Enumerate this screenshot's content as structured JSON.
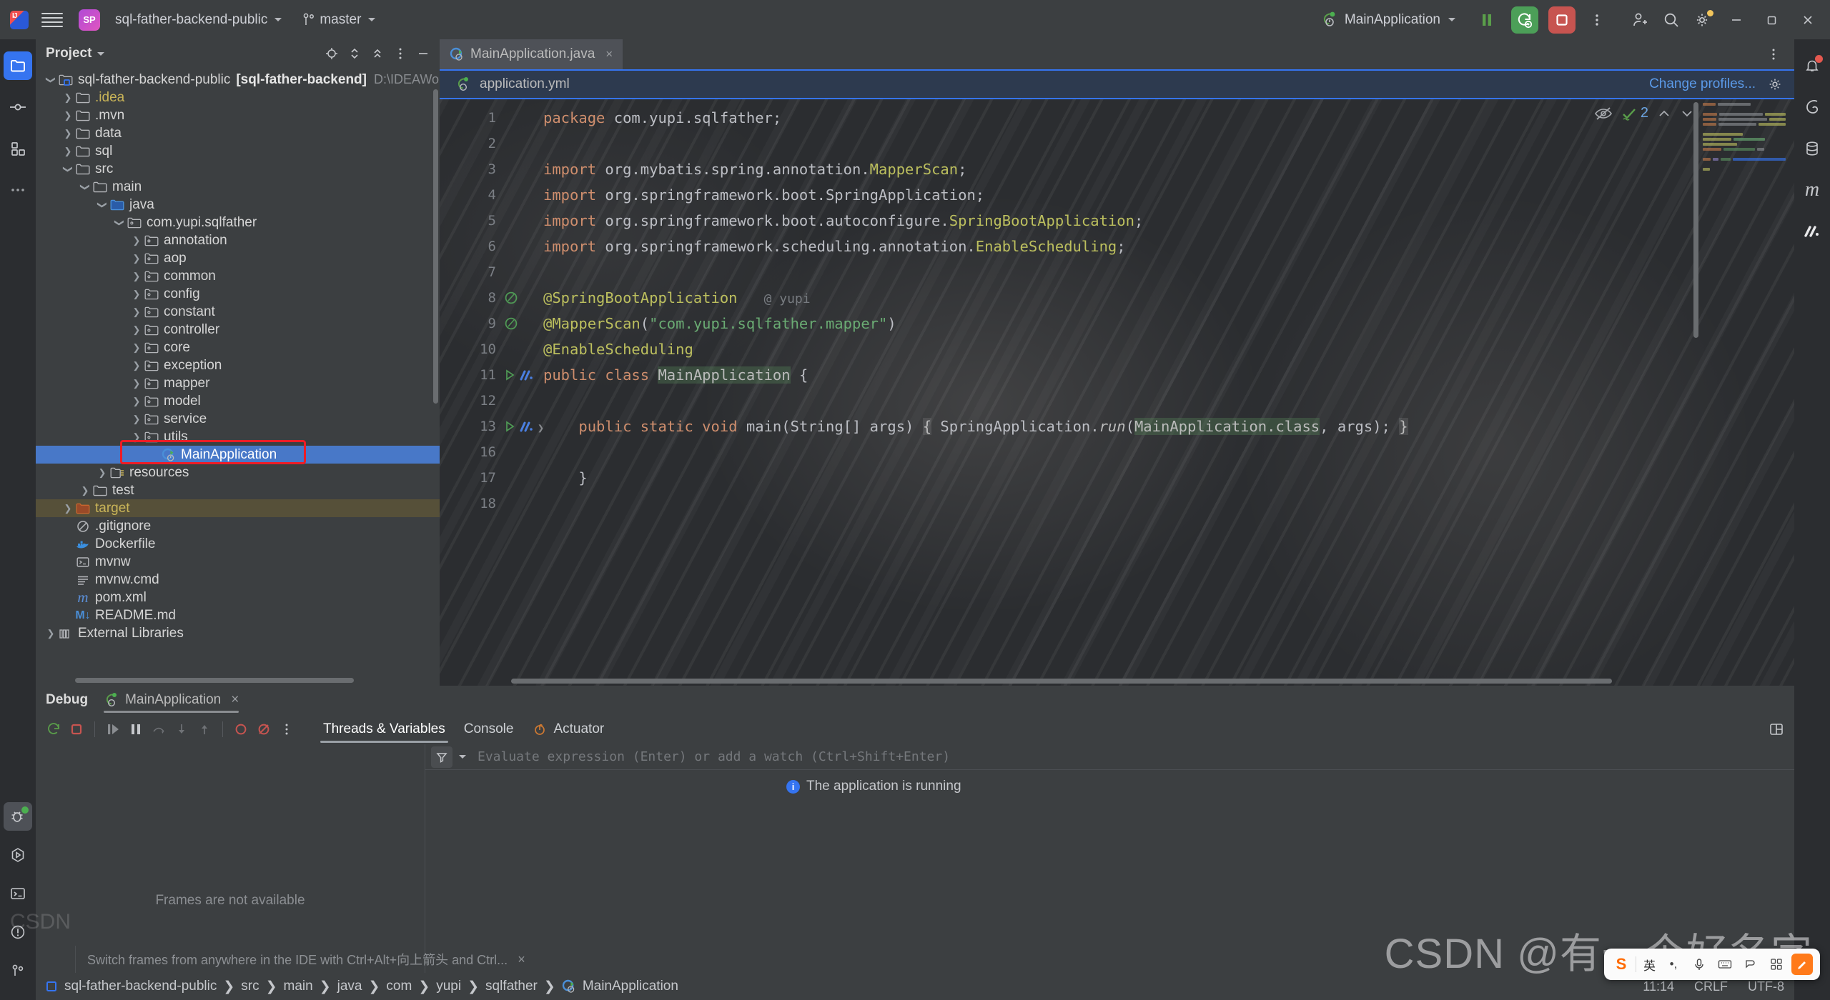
{
  "titlebar": {
    "project_badge": "SP",
    "project_name": "sql-father-backend-public",
    "branch": "master",
    "run_config": "MainApplication",
    "buttons": {
      "pause": "pause-icon",
      "rerun_debug": "rerun-debug-icon",
      "stop": "stop-icon",
      "more": "more-options-icon",
      "add_user": "add-user-icon",
      "search": "search-icon",
      "settings": "settings-icon",
      "minimize": "minimize",
      "maximize": "maximize",
      "close": "close"
    }
  },
  "left_rail": [
    {
      "name": "project-tool-window",
      "icon": "folder-icon",
      "active": true
    },
    {
      "name": "commit-tool-window",
      "icon": "commit-icon",
      "active": false
    },
    {
      "name": "structure-tool-window",
      "icon": "structure-icon",
      "active": false
    },
    {
      "name": "more-tool-windows",
      "icon": "ellipsis-icon",
      "active": false
    }
  ],
  "left_rail_bottom": [
    {
      "name": "debug-tool-window",
      "icon": "bug-icon",
      "active": true
    },
    {
      "name": "run-tool-window",
      "icon": "run-icon",
      "active": false
    },
    {
      "name": "terminal-tool-window",
      "icon": "terminal-icon",
      "active": false
    },
    {
      "name": "problems-tool-window",
      "icon": "warning-icon",
      "active": false
    },
    {
      "name": "version-control-tool-window",
      "icon": "branch-icon",
      "active": false
    }
  ],
  "right_rail": [
    {
      "name": "notifications",
      "icon": "bell-icon",
      "badge": true
    },
    {
      "name": "spring",
      "icon": "spring-leaf-icon"
    },
    {
      "name": "database",
      "icon": "database-icon"
    },
    {
      "name": "maven",
      "icon": "maven-m-icon"
    },
    {
      "name": "ai-assistant",
      "icon": "ai-icon"
    }
  ],
  "project_panel": {
    "title": "Project",
    "tools": [
      "locate-icon",
      "expand-collapse-icon",
      "collapse-all-icon",
      "options-icon",
      "hide-icon"
    ],
    "tree": [
      {
        "depth": 0,
        "arrow": "down",
        "icon": "module-icon",
        "label": "sql-father-backend-public",
        "bold": "[sql-father-backend]",
        "sub": "D:\\IDEAWorkSpace"
      },
      {
        "depth": 1,
        "arrow": "right",
        "icon": "folder-icon",
        "label": ".idea",
        "style": "idea"
      },
      {
        "depth": 1,
        "arrow": "right",
        "icon": "folder-icon",
        "label": ".mvn"
      },
      {
        "depth": 1,
        "arrow": "right",
        "icon": "folder-icon",
        "label": "data"
      },
      {
        "depth": 1,
        "arrow": "right",
        "icon": "folder-icon",
        "label": "sql"
      },
      {
        "depth": 1,
        "arrow": "down",
        "icon": "folder-icon",
        "label": "src"
      },
      {
        "depth": 2,
        "arrow": "down",
        "icon": "folder-icon",
        "label": "main"
      },
      {
        "depth": 3,
        "arrow": "down",
        "icon": "source-folder-icon",
        "label": "java"
      },
      {
        "depth": 4,
        "arrow": "down",
        "icon": "package-icon",
        "label": "com.yupi.sqlfather"
      },
      {
        "depth": 5,
        "arrow": "right",
        "icon": "package-icon",
        "label": "annotation"
      },
      {
        "depth": 5,
        "arrow": "right",
        "icon": "package-icon",
        "label": "aop"
      },
      {
        "depth": 5,
        "arrow": "right",
        "icon": "package-icon",
        "label": "common"
      },
      {
        "depth": 5,
        "arrow": "right",
        "icon": "package-icon",
        "label": "config"
      },
      {
        "depth": 5,
        "arrow": "right",
        "icon": "package-icon",
        "label": "constant"
      },
      {
        "depth": 5,
        "arrow": "right",
        "icon": "package-icon",
        "label": "controller"
      },
      {
        "depth": 5,
        "arrow": "right",
        "icon": "package-icon",
        "label": "core"
      },
      {
        "depth": 5,
        "arrow": "right",
        "icon": "package-icon",
        "label": "exception"
      },
      {
        "depth": 5,
        "arrow": "right",
        "icon": "package-icon",
        "label": "mapper"
      },
      {
        "depth": 5,
        "arrow": "right",
        "icon": "package-icon",
        "label": "model"
      },
      {
        "depth": 5,
        "arrow": "right",
        "icon": "package-icon",
        "label": "service"
      },
      {
        "depth": 5,
        "arrow": "right",
        "icon": "package-icon",
        "label": "utils"
      },
      {
        "depth": 5,
        "arrow": "none",
        "icon": "spring-class-icon",
        "label": "MainApplication",
        "selected": true
      },
      {
        "depth": 3,
        "arrow": "right",
        "icon": "resources-folder-icon",
        "label": "resources"
      },
      {
        "depth": 2,
        "arrow": "right",
        "icon": "folder-icon",
        "label": "test"
      },
      {
        "depth": 1,
        "arrow": "right",
        "icon": "excluded-folder-icon",
        "label": "target",
        "style": "target"
      },
      {
        "depth": 1,
        "arrow": "none",
        "icon": "gitignore-icon",
        "label": ".gitignore"
      },
      {
        "depth": 1,
        "arrow": "none",
        "icon": "docker-icon",
        "label": "Dockerfile"
      },
      {
        "depth": 1,
        "arrow": "none",
        "icon": "shell-icon",
        "label": "mvnw"
      },
      {
        "depth": 1,
        "arrow": "none",
        "icon": "cmd-icon",
        "label": "mvnw.cmd"
      },
      {
        "depth": 1,
        "arrow": "none",
        "icon": "maven-m-icon",
        "label": "pom.xml"
      },
      {
        "depth": 1,
        "arrow": "none",
        "icon": "markdown-icon",
        "label": "README.md"
      },
      {
        "depth": 0,
        "arrow": "right",
        "icon": "libraries-icon",
        "label": "External Libraries"
      }
    ]
  },
  "editor": {
    "tab": {
      "label": "MainApplication.java",
      "icon": "spring-class-icon",
      "close": "×"
    },
    "yml_bar": {
      "icon": "spring-bean-icon",
      "label": "application.yml",
      "change_profiles": "Change profiles...",
      "gear": "settings-icon"
    },
    "inspection": {
      "eye": "inspections-off-icon",
      "check": "✓",
      "count": "2",
      "up": "^",
      "down": "v"
    },
    "lines": [
      {
        "n": "1",
        "marks": [],
        "tokens": [
          {
            "t": "package ",
            "c": "k"
          },
          {
            "t": "com.yupi.sqlfather;",
            "c": "pln"
          }
        ]
      },
      {
        "n": "2",
        "marks": [],
        "tokens": []
      },
      {
        "n": "3",
        "marks": [],
        "tokens": [
          {
            "t": "import ",
            "c": "k"
          },
          {
            "t": "org.mybatis.spring.annotation.",
            "c": "pln"
          },
          {
            "t": "MapperScan",
            "c": "ann"
          },
          {
            "t": ";",
            "c": "pln"
          }
        ]
      },
      {
        "n": "4",
        "marks": [],
        "tokens": [
          {
            "t": "import ",
            "c": "k"
          },
          {
            "t": "org.springframework.boot.",
            "c": "pln"
          },
          {
            "t": "SpringApplication",
            "c": "pln"
          },
          {
            "t": ";",
            "c": "pln"
          }
        ]
      },
      {
        "n": "5",
        "marks": [],
        "tokens": [
          {
            "t": "import ",
            "c": "k"
          },
          {
            "t": "org.springframework.boot.autoconfigure.",
            "c": "pln"
          },
          {
            "t": "SpringBootApplication",
            "c": "ann"
          },
          {
            "t": ";",
            "c": "pln"
          }
        ]
      },
      {
        "n": "6",
        "marks": [],
        "tokens": [
          {
            "t": "import ",
            "c": "k"
          },
          {
            "t": "org.springframework.scheduling.annotation.",
            "c": "pln"
          },
          {
            "t": "EnableScheduling",
            "c": "ann"
          },
          {
            "t": ";",
            "c": "pln"
          }
        ]
      },
      {
        "n": "7",
        "marks": [],
        "tokens": []
      },
      {
        "n": "8",
        "marks": [
          "bean-gutter-icon"
        ],
        "tokens": [
          {
            "t": "@SpringBootApplication",
            "c": "ann"
          },
          {
            "t": "   ",
            "c": "pln"
          },
          {
            "t": "@ yupi",
            "c": "hint"
          }
        ]
      },
      {
        "n": "9",
        "marks": [
          "bean-gutter-icon"
        ],
        "tokens": [
          {
            "t": "@MapperScan",
            "c": "ann"
          },
          {
            "t": "(",
            "c": "pln"
          },
          {
            "t": "\"com.yupi.sqlfather.mapper\"",
            "c": "str"
          },
          {
            "t": ")",
            "c": "pln"
          }
        ]
      },
      {
        "n": "10",
        "marks": [],
        "tokens": [
          {
            "t": "@EnableScheduling",
            "c": "ann"
          }
        ]
      },
      {
        "n": "11",
        "marks": [
          "run-gutter-icon",
          "ai-gutter-icon"
        ],
        "tokens": [
          {
            "t": "public ",
            "c": "k"
          },
          {
            "t": "class ",
            "c": "k"
          },
          {
            "t": "MainApplication",
            "c": "hlgreen"
          },
          {
            "t": " {",
            "c": "pln"
          }
        ]
      },
      {
        "n": "12",
        "marks": [],
        "tokens": []
      },
      {
        "n": "13",
        "marks": [
          "run-gutter-icon",
          "ai-gutter-icon",
          "fold-icon"
        ],
        "tokens": [
          {
            "t": "    public ",
            "c": "k"
          },
          {
            "t": "static ",
            "c": "k"
          },
          {
            "t": "void ",
            "c": "k"
          },
          {
            "t": "main",
            "c": "idn"
          },
          {
            "t": "(String[] args) ",
            "c": "pln"
          },
          {
            "t": "{",
            "c": "hlgray"
          },
          {
            "t": " SpringApplication.",
            "c": "pln"
          },
          {
            "t": "run",
            "c": "ital"
          },
          {
            "t": "(",
            "c": "pln"
          },
          {
            "t": "MainApplication.class",
            "c": "hlgreen"
          },
          {
            "t": ", args); ",
            "c": "pln"
          },
          {
            "t": "}",
            "c": "hlgray"
          }
        ]
      },
      {
        "n": "16",
        "marks": [],
        "tokens": []
      },
      {
        "n": "17",
        "marks": [],
        "tokens": [
          {
            "t": "    }",
            "c": "pln"
          }
        ]
      },
      {
        "n": "18",
        "marks": [],
        "tokens": []
      }
    ]
  },
  "debug": {
    "panel_label": "Debug",
    "session_tab": "MainApplication",
    "session_close": "×",
    "toolbar": [
      "rerun-icon",
      "stop-icon",
      "resume-icon",
      "pause-icon",
      "step-over-icon",
      "step-into-icon",
      "step-out-icon",
      "mute-breakpoints-icon",
      "view-breakpoints-icon",
      "more-icon"
    ],
    "tabs": [
      {
        "label": "Threads & Variables",
        "active": true,
        "icon": ""
      },
      {
        "label": "Console",
        "active": false,
        "icon": ""
      },
      {
        "label": "Actuator",
        "active": false,
        "icon": "actuator-icon"
      }
    ],
    "layout_button": "layout-settings-icon",
    "frames_placeholder": "Frames are not available",
    "eval_placeholder": "Evaluate expression (Enter) or add a watch (Ctrl+Shift+Enter)",
    "filter_icon": "filter-icon",
    "message": "The application is running",
    "hint": "Switch frames from anywhere in the IDE with Ctrl+Alt+向上箭头 and Ctrl...",
    "hint_close": "×"
  },
  "statusbar": {
    "breadcrumb": [
      "sql-father-backend-public",
      "src",
      "main",
      "java",
      "com",
      "yupi",
      "sqlfather",
      "MainApplication"
    ],
    "breadcrumb_leaf_icon": "spring-class-icon",
    "right": [
      "11:14",
      "CRLF",
      "UTF-8"
    ]
  },
  "watermark": "CSDN @有一个好名字",
  "ime": {
    "logo": "S",
    "mode": "英",
    "items": [
      "punctuation-icon",
      "voice-icon",
      "keyboard-icon",
      "emoji-icon",
      "apps-icon",
      "pen-icon"
    ]
  },
  "colors": {
    "accent": "#3574f0",
    "selection": "#4878c8",
    "highlight_box": "#ee1c25",
    "run_green": "#4c9f58",
    "stop_red": "#c75450"
  }
}
